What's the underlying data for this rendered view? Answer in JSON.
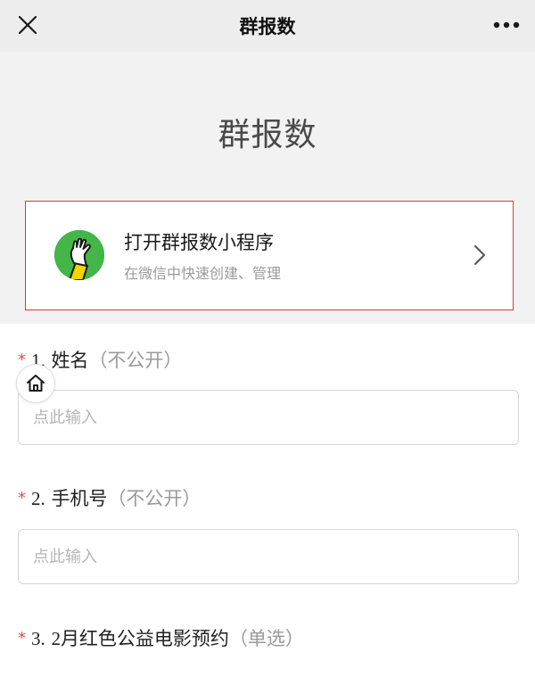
{
  "nav": {
    "title": "群报数",
    "close_icon": "close-icon",
    "more_icon": "more-dots-icon"
  },
  "banner": {
    "title": "群报数"
  },
  "miniprogram": {
    "name": "打开群报数小程序",
    "description": "在微信中快速创建、管理",
    "logo_icon": "raised-hand-icon",
    "arrow_icon": "chevron-right-icon",
    "accent": "#43b549",
    "highlight_border": "#e8333a"
  },
  "questions": [
    {
      "required_mark": "*",
      "number": "1.",
      "label": "姓名",
      "hint": "（不公开）",
      "placeholder": "点此输入",
      "value": ""
    },
    {
      "required_mark": "*",
      "number": "2.",
      "label": "手机号",
      "hint": "（不公开）",
      "placeholder": "点此输入",
      "value": ""
    },
    {
      "required_mark": "*",
      "number": "3.",
      "label": "2月红色公益电影预约",
      "hint": "（单选）"
    }
  ],
  "floating": {
    "home_icon": "home-icon"
  }
}
